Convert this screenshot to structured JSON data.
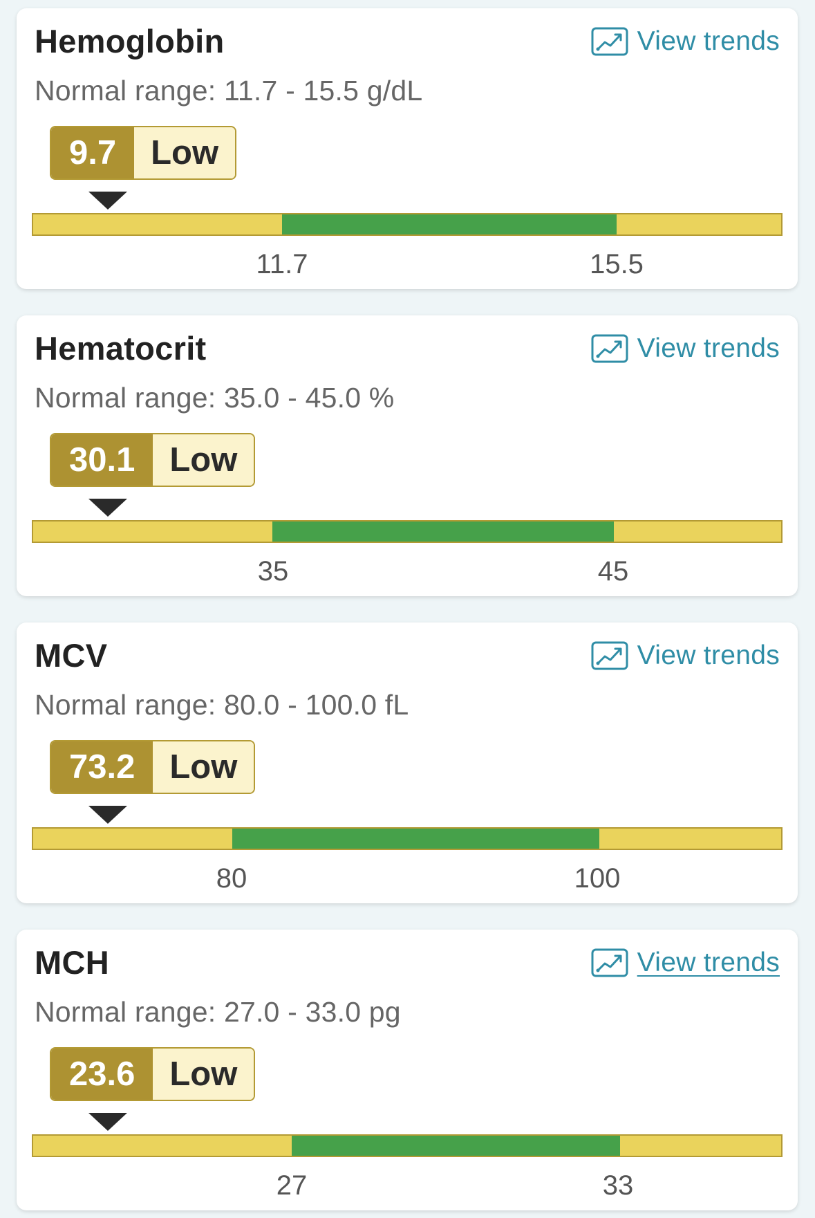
{
  "colors": {
    "page_background": "#eef5f7",
    "badge_value_bg": "#ad9232",
    "badge_status_bg": "#fbf3cd",
    "range_low_high": "#ead35c",
    "range_normal": "#46a14a",
    "link": "#2f8da6"
  },
  "tests": [
    {
      "title": "Hemoglobin",
      "trends_label": "View trends",
      "trends_icon": "line-chart-icon",
      "range_text": "Normal range: 11.7 - 15.5 g/dL",
      "value": "9.7",
      "status": "Low",
      "low_tick": "11.7",
      "high_tick": "15.5",
      "normal_start_fraction": 0.333,
      "normal_end_fraction": 0.78
    },
    {
      "title": "Hematocrit",
      "trends_label": "View trends",
      "trends_icon": "line-chart-icon",
      "range_text": "Normal range: 35.0 - 45.0 %",
      "value": "30.1",
      "status": "Low",
      "low_tick": "35",
      "high_tick": "45",
      "normal_start_fraction": 0.32,
      "normal_end_fraction": 0.776
    },
    {
      "title": "MCV",
      "trends_label": "View trends",
      "trends_icon": "line-chart-icon",
      "range_text": "Normal range: 80.0 - 100.0 fL",
      "value": "73.2",
      "status": "Low",
      "low_tick": "80",
      "high_tick": "100",
      "normal_start_fraction": 0.266,
      "normal_end_fraction": 0.757
    },
    {
      "title": "MCH",
      "trends_label": "View trends",
      "trends_icon": "line-chart-icon",
      "range_text": "Normal range: 27.0 - 33.0 pg",
      "value": "23.6",
      "status": "Low",
      "low_tick": "27",
      "high_tick": "33",
      "normal_start_fraction": 0.346,
      "normal_end_fraction": 0.785
    }
  ]
}
